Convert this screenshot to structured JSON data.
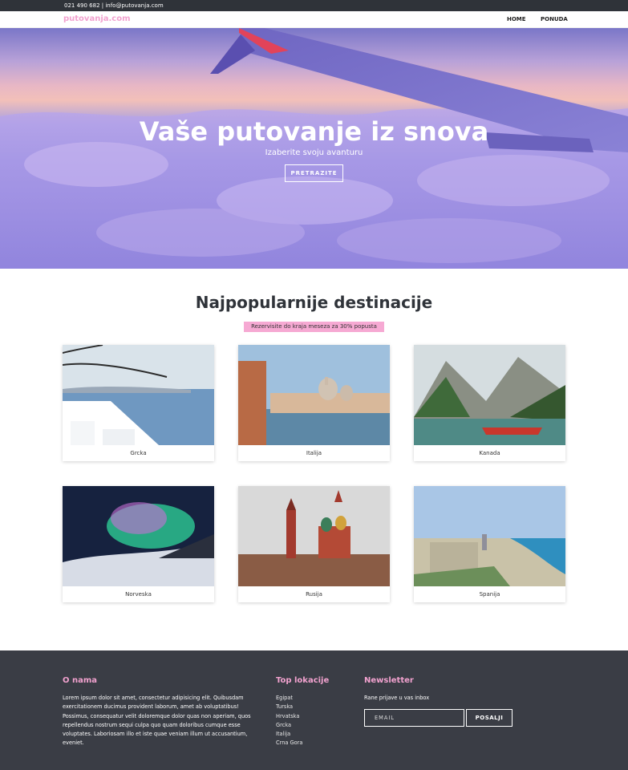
{
  "topbar": {
    "contact": "021 490 682 |  info@putovanja.com"
  },
  "navbar": {
    "logo": "putovanja.com",
    "links": [
      "HOME",
      "PONUDA"
    ]
  },
  "hero": {
    "title": "Vaše putovanje iz snova",
    "subtitle": "Izaberite svoju avanturu",
    "button": "PRETRAZITE"
  },
  "destinations": {
    "title": "Najpopularnije destinacije",
    "badge": "Rezervisite do kraja meseza za 30% popusta",
    "cards": [
      {
        "label": "Grcka"
      },
      {
        "label": "Italija"
      },
      {
        "label": "Kanada"
      },
      {
        "label": "Norveska"
      },
      {
        "label": "Rusija"
      },
      {
        "label": "Spanija"
      }
    ]
  },
  "footer": {
    "about": {
      "title": "O nama",
      "text": "Lorem ipsum dolor sit amet, consectetur adipisicing elit. Quibusdam exercitationem ducimus provident laborum, amet ab voluptatibus! Possimus, consequatur velit doloremque dolor quas non aperiam, quos repellendus nostrum sequi culpa quo quam doloribus cumque esse voluptates. Laboriosam illo et iste quae veniam illum ut accusantium, eveniet."
    },
    "top_locations": {
      "title": "Top lokacije",
      "items": [
        "Egipat",
        "Turska",
        "Hrvatska",
        "Grcka",
        "Italija",
        "Crna Gora"
      ]
    },
    "newsletter": {
      "title": "Newsletter",
      "subtitle": "Rane prijave u vas inbox",
      "email_placeholder": "EMAIL",
      "button": "POSALJI"
    }
  },
  "colors": {
    "accent": "#f2a2cf",
    "dark": "#3a3d45",
    "topbar": "#2f3339"
  }
}
